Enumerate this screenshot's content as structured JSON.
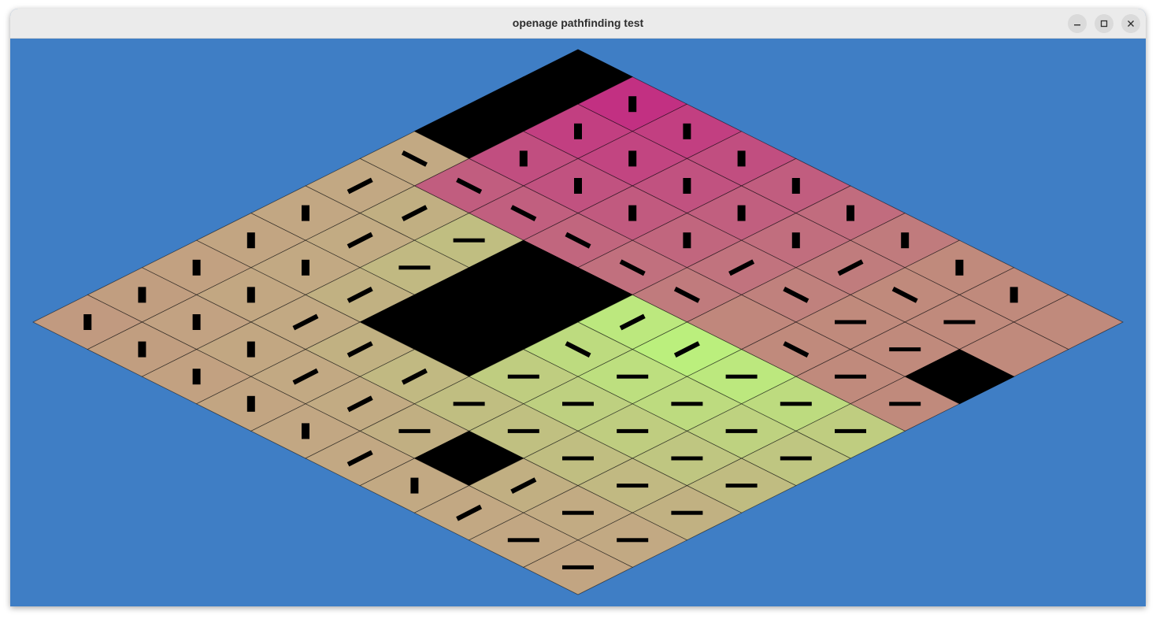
{
  "window": {
    "title": "openage pathfinding test",
    "controls": [
      {
        "name": "minimize-button",
        "icon": "minimize-icon"
      },
      {
        "name": "maximize-button",
        "icon": "maximize-icon"
      },
      {
        "name": "close-button",
        "icon": "close-icon"
      }
    ]
  },
  "colors": {
    "background": "#3f7ec5",
    "start_cost_color": "#c23082",
    "target_color": "#bafe7c",
    "neutral_tile_color": "#c2a983",
    "obstacle_color": "#000000",
    "arrow_color": "#000000"
  },
  "grid": {
    "size": 10,
    "target": {
      "row": 3,
      "col": 6
    },
    "obstacles": [
      [
        0,
        0
      ],
      [
        1,
        0
      ],
      [
        2,
        0
      ],
      [
        4,
        3
      ],
      [
        4,
        4
      ],
      [
        5,
        3
      ],
      [
        5,
        4
      ],
      [
        6,
        3
      ],
      [
        6,
        4
      ],
      [
        8,
        6
      ],
      [
        2,
        9
      ]
    ],
    "pink_cells": [
      [
        0,
        1
      ],
      [
        0,
        2
      ],
      [
        0,
        3
      ],
      [
        0,
        4
      ],
      [
        0,
        5
      ],
      [
        0,
        6
      ],
      [
        0,
        7
      ],
      [
        0,
        8
      ],
      [
        0,
        9
      ],
      [
        1,
        1
      ],
      [
        1,
        2
      ],
      [
        1,
        3
      ],
      [
        1,
        4
      ],
      [
        1,
        5
      ],
      [
        1,
        6
      ],
      [
        1,
        7
      ],
      [
        1,
        8
      ],
      [
        1,
        9
      ],
      [
        2,
        1
      ],
      [
        2,
        2
      ],
      [
        2,
        3
      ],
      [
        2,
        4
      ],
      [
        2,
        5
      ],
      [
        2,
        6
      ],
      [
        2,
        7
      ],
      [
        2,
        8
      ],
      [
        3,
        1
      ],
      [
        3,
        2
      ],
      [
        3,
        3
      ],
      [
        3,
        4
      ],
      [
        3,
        5
      ],
      [
        3,
        6
      ],
      [
        3,
        7
      ],
      [
        3,
        8
      ],
      [
        3,
        9
      ]
    ],
    "flow_arrows": [
      {
        "row": 0,
        "col": 1,
        "dir": "V"
      },
      {
        "row": 0,
        "col": 2,
        "dir": "V"
      },
      {
        "row": 0,
        "col": 3,
        "dir": "V"
      },
      {
        "row": 0,
        "col": 4,
        "dir": "V"
      },
      {
        "row": 0,
        "col": 5,
        "dir": "V"
      },
      {
        "row": 0,
        "col": 6,
        "dir": "V"
      },
      {
        "row": 0,
        "col": 7,
        "dir": "V"
      },
      {
        "row": 0,
        "col": 8,
        "dir": "V"
      },
      {
        "row": 1,
        "col": 1,
        "dir": "V"
      },
      {
        "row": 1,
        "col": 2,
        "dir": "V"
      },
      {
        "row": 1,
        "col": 3,
        "dir": "V"
      },
      {
        "row": 1,
        "col": 4,
        "dir": "V"
      },
      {
        "row": 1,
        "col": 5,
        "dir": "V"
      },
      {
        "row": 1,
        "col": 6,
        "dir": "D1"
      },
      {
        "row": 1,
        "col": 7,
        "dir": "D2"
      },
      {
        "row": 1,
        "col": 8,
        "dir": "H"
      },
      {
        "row": 2,
        "col": 1,
        "dir": "V"
      },
      {
        "row": 2,
        "col": 2,
        "dir": "V"
      },
      {
        "row": 2,
        "col": 3,
        "dir": "V"
      },
      {
        "row": 2,
        "col": 4,
        "dir": "V"
      },
      {
        "row": 2,
        "col": 5,
        "dir": "D1"
      },
      {
        "row": 2,
        "col": 6,
        "dir": "D2"
      },
      {
        "row": 2,
        "col": 7,
        "dir": "H"
      },
      {
        "row": 2,
        "col": 8,
        "dir": "H"
      },
      {
        "row": 3,
        "col": 0,
        "dir": "D2"
      },
      {
        "row": 3,
        "col": 1,
        "dir": "D2"
      },
      {
        "row": 3,
        "col": 2,
        "dir": "D2"
      },
      {
        "row": 3,
        "col": 3,
        "dir": "D2"
      },
      {
        "row": 3,
        "col": 4,
        "dir": "D2"
      },
      {
        "row": 3,
        "col": 5,
        "dir": "D2"
      },
      {
        "row": 3,
        "col": 7,
        "dir": "D2"
      },
      {
        "row": 3,
        "col": 8,
        "dir": "H"
      },
      {
        "row": 3,
        "col": 9,
        "dir": "H"
      },
      {
        "row": 4,
        "col": 0,
        "dir": "D1"
      },
      {
        "row": 4,
        "col": 1,
        "dir": "D1"
      },
      {
        "row": 4,
        "col": 2,
        "dir": "H"
      },
      {
        "row": 4,
        "col": 5,
        "dir": "D1"
      },
      {
        "row": 4,
        "col": 6,
        "dir": "D1"
      },
      {
        "row": 4,
        "col": 7,
        "dir": "H"
      },
      {
        "row": 4,
        "col": 8,
        "dir": "H"
      },
      {
        "row": 4,
        "col": 9,
        "dir": "H"
      },
      {
        "row": 5,
        "col": 0,
        "dir": "V"
      },
      {
        "row": 5,
        "col": 1,
        "dir": "D1"
      },
      {
        "row": 5,
        "col": 2,
        "dir": "H"
      },
      {
        "row": 5,
        "col": 5,
        "dir": "D2"
      },
      {
        "row": 5,
        "col": 6,
        "dir": "H"
      },
      {
        "row": 5,
        "col": 7,
        "dir": "H"
      },
      {
        "row": 5,
        "col": 8,
        "dir": "H"
      },
      {
        "row": 5,
        "col": 9,
        "dir": "H"
      },
      {
        "row": 6,
        "col": 0,
        "dir": "V"
      },
      {
        "row": 6,
        "col": 1,
        "dir": "V"
      },
      {
        "row": 6,
        "col": 2,
        "dir": "D1"
      },
      {
        "row": 6,
        "col": 5,
        "dir": "H"
      },
      {
        "row": 6,
        "col": 6,
        "dir": "H"
      },
      {
        "row": 6,
        "col": 7,
        "dir": "H"
      },
      {
        "row": 6,
        "col": 8,
        "dir": "H"
      },
      {
        "row": 6,
        "col": 9,
        "dir": "H"
      },
      {
        "row": 7,
        "col": 0,
        "dir": "V"
      },
      {
        "row": 7,
        "col": 1,
        "dir": "V"
      },
      {
        "row": 7,
        "col": 2,
        "dir": "D1"
      },
      {
        "row": 7,
        "col": 3,
        "dir": "D1"
      },
      {
        "row": 7,
        "col": 4,
        "dir": "D1"
      },
      {
        "row": 7,
        "col": 5,
        "dir": "H"
      },
      {
        "row": 7,
        "col": 6,
        "dir": "H"
      },
      {
        "row": 7,
        "col": 7,
        "dir": "H"
      },
      {
        "row": 7,
        "col": 8,
        "dir": "H"
      },
      {
        "row": 7,
        "col": 9,
        "dir": "H"
      },
      {
        "row": 8,
        "col": 0,
        "dir": "V"
      },
      {
        "row": 8,
        "col": 1,
        "dir": "V"
      },
      {
        "row": 8,
        "col": 2,
        "dir": "V"
      },
      {
        "row": 8,
        "col": 3,
        "dir": "D1"
      },
      {
        "row": 8,
        "col": 4,
        "dir": "D1"
      },
      {
        "row": 8,
        "col": 5,
        "dir": "H"
      },
      {
        "row": 8,
        "col": 7,
        "dir": "D1"
      },
      {
        "row": 8,
        "col": 8,
        "dir": "H"
      },
      {
        "row": 8,
        "col": 9,
        "dir": "H"
      },
      {
        "row": 9,
        "col": 0,
        "dir": "V"
      },
      {
        "row": 9,
        "col": 1,
        "dir": "V"
      },
      {
        "row": 9,
        "col": 2,
        "dir": "V"
      },
      {
        "row": 9,
        "col": 3,
        "dir": "V"
      },
      {
        "row": 9,
        "col": 4,
        "dir": "V"
      },
      {
        "row": 9,
        "col": 5,
        "dir": "D1"
      },
      {
        "row": 9,
        "col": 6,
        "dir": "V"
      },
      {
        "row": 9,
        "col": 7,
        "dir": "D1"
      },
      {
        "row": 9,
        "col": 8,
        "dir": "H"
      },
      {
        "row": 9,
        "col": 9,
        "dir": "H"
      }
    ]
  }
}
